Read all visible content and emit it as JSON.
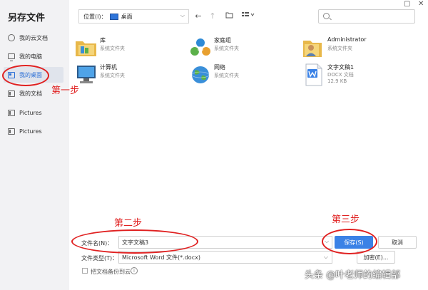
{
  "dialog_title": "另存文件",
  "sidebar": {
    "items": [
      {
        "label": "我的云文档"
      },
      {
        "label": "我的电脑"
      },
      {
        "label": "我的桌面"
      },
      {
        "label": "我的文档"
      },
      {
        "label": "Pictures"
      },
      {
        "label": "Pictures"
      }
    ]
  },
  "toolbar": {
    "location_label": "位置(I)：",
    "location_value": "桌面"
  },
  "search": {
    "value": "",
    "placeholder": ""
  },
  "files": [
    {
      "name": "库",
      "sub": [
        "系统文件夹"
      ]
    },
    {
      "name": "家庭组",
      "sub": [
        "系统文件夹"
      ]
    },
    {
      "name": "Administrator",
      "sub": [
        "系统文件夹"
      ]
    },
    {
      "name": "计算机",
      "sub": [
        "系统文件夹"
      ]
    },
    {
      "name": "网络",
      "sub": [
        "系统文件夹"
      ]
    },
    {
      "name": "文字文稿1",
      "sub": [
        "DOCX 文档",
        "12.9 KB"
      ]
    }
  ],
  "form": {
    "filename_label": "文件名(N)：",
    "filename_value": "文字文稿3",
    "filetype_label": "文件类型(T)：",
    "filetype_value": "Microsoft Word 文件(*.docx)",
    "backup_label": "把文档备份到云",
    "save_label": "保存(S)",
    "cancel_label": "取消",
    "encrypt_label": "加密(E)..."
  },
  "annotations": {
    "step1": "第一步",
    "step2": "第二步",
    "step3": "第三步"
  },
  "watermark": "头条 @叶老师的编辑部",
  "colors": {
    "accent": "#3b82e6",
    "annotation": "#e02020"
  }
}
